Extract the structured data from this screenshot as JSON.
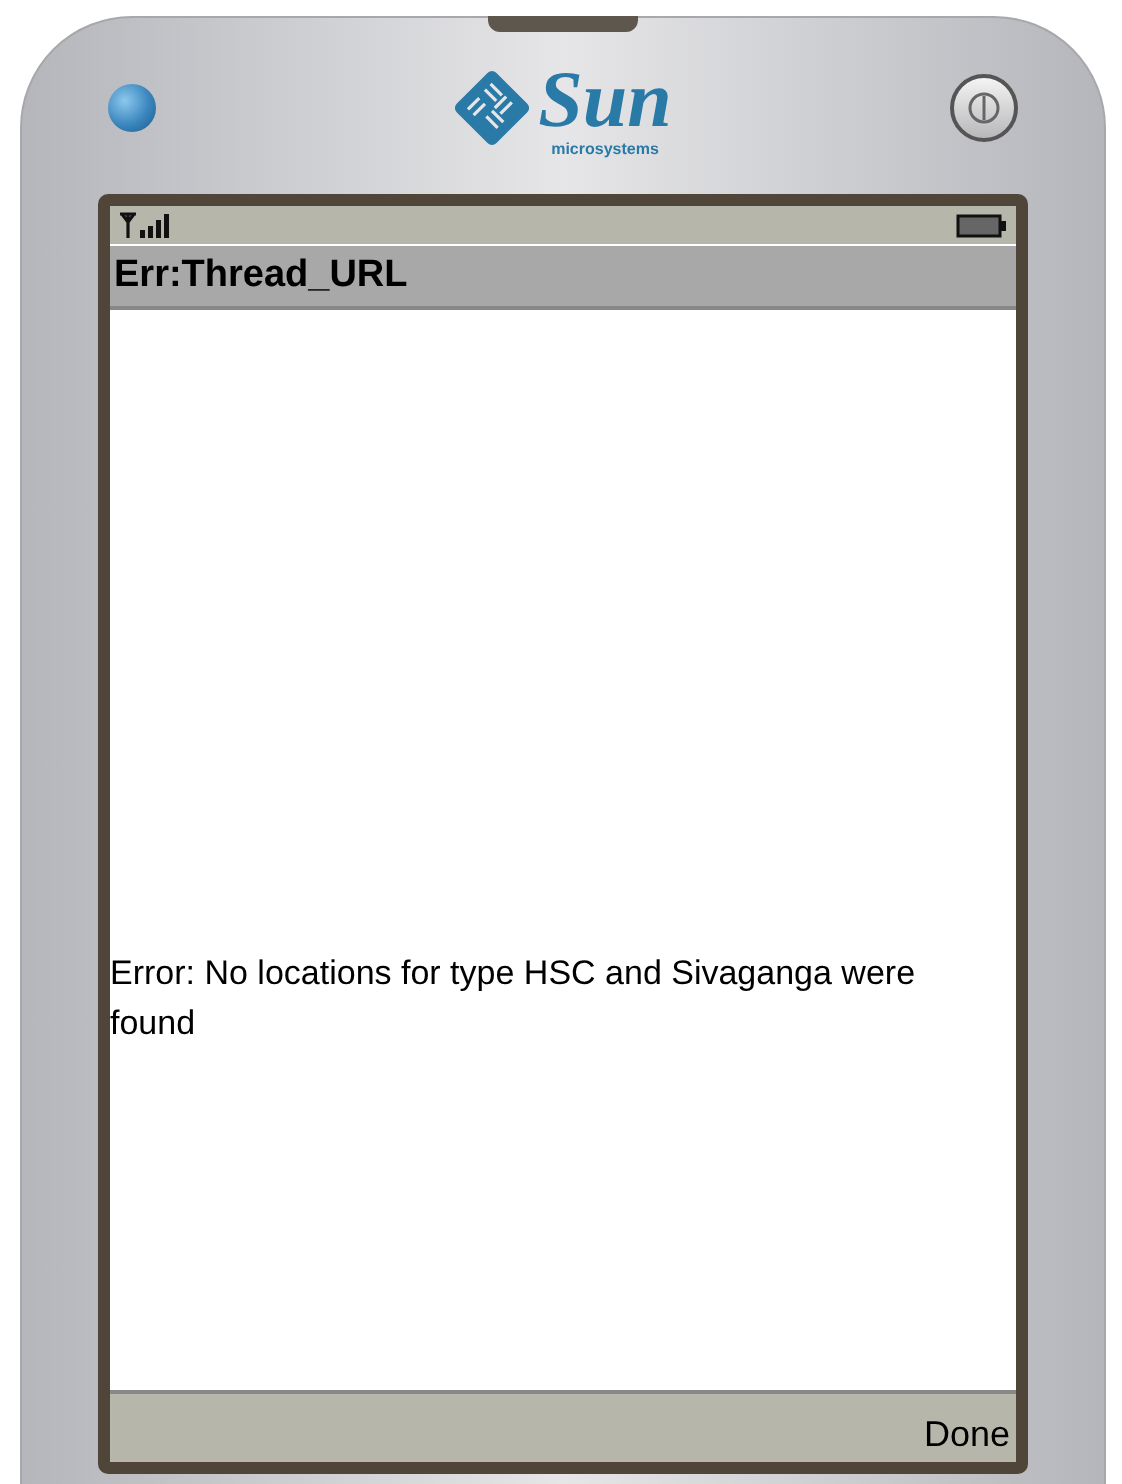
{
  "logo": {
    "name": "Sun",
    "tagline": "microsystems"
  },
  "screen": {
    "title": "Err:Thread_URL",
    "message": "Error: No locations for type HSC and Sivaganga were found",
    "softkey": "Done"
  }
}
